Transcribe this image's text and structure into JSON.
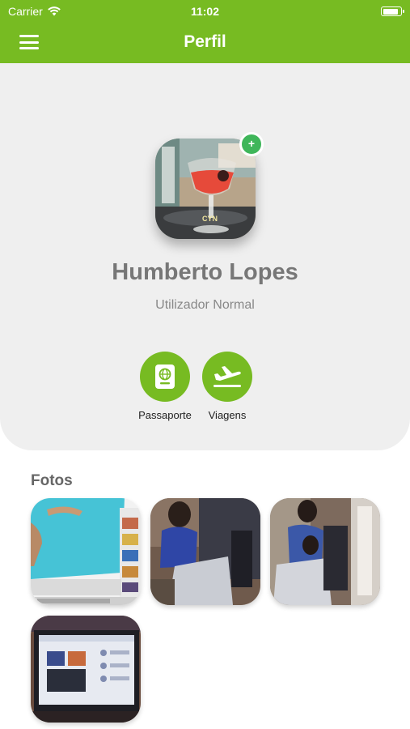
{
  "status_bar": {
    "carrier": "Carrier",
    "time": "11:02",
    "battery_level": 0.9
  },
  "header": {
    "title": "Perfil",
    "menu_icon": "hamburger-menu-icon"
  },
  "profile": {
    "name": "Humberto Lopes",
    "role": "Utilizador Normal",
    "avatar_badge": "+"
  },
  "actions": [
    {
      "label": "Passaporte",
      "icon": "passport-icon"
    },
    {
      "label": "Viagens",
      "icon": "airplane-icon"
    }
  ],
  "photos_section": {
    "title": "Fotos"
  },
  "colors": {
    "primary": "#77bb22",
    "badge": "#3fb65a",
    "card_bg": "#efefef"
  }
}
